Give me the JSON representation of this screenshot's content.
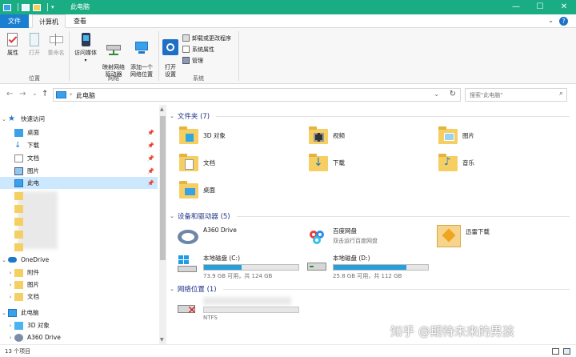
{
  "window": {
    "title": "此电脑",
    "accent": "#1aad84",
    "controls": {
      "minimize": "—",
      "maximize": "☐",
      "close": "✕"
    }
  },
  "ribbon_tabs": {
    "file": "文件",
    "computer": "计算机",
    "view": "查看",
    "help": "?"
  },
  "ribbon": {
    "location": {
      "label": "位置",
      "properties": "属性",
      "open": "打开",
      "rename": "重命名"
    },
    "network": {
      "label": "网络",
      "access_media": "访问媒体",
      "map_drive": "映射网络\n驱动器",
      "add_location": "添加一个\n网络位置"
    },
    "system": {
      "label": "系统",
      "open_settings": "打开\n设置",
      "uninstall": "卸载或更改程序",
      "system_properties": "系统属性",
      "manage": "管理"
    }
  },
  "address": {
    "back": "←",
    "forward": "→",
    "recent": "⌄",
    "up": "↑",
    "crumb": "此电脑",
    "crumb_separator": "›",
    "search_placeholder": "搜索\"此电脑\""
  },
  "nav": {
    "quick_access": "快速访问",
    "desktop": "桌面",
    "downloads": "下载",
    "documents": "文档",
    "pictures": "图片",
    "this_pc_partial": "此电",
    "onedrive": "OneDrive",
    "attachments": "附件",
    "od_pictures": "图片",
    "od_documents": "文档",
    "this_pc": "此电脑",
    "objects3d": "3D 对象",
    "a360": "A360 Drive"
  },
  "content": {
    "folders_header": "文件夹 (7)",
    "folders": [
      "3D 对象",
      "视频",
      "图片",
      "文档",
      "下载",
      "音乐",
      "桌面"
    ],
    "devices_header": "设备和驱动器 (5)",
    "devices": {
      "a360": "A360 Drive",
      "baidu_name": "百度网盘",
      "baidu_desc": "双击运行百度网盘",
      "xunlei": "迅雷下载",
      "c_name": "本地磁盘 (C:)",
      "c_space": "73.9 GB 可用，共 124 GB",
      "c_used": 0.4,
      "d_name": "本地磁盘 (D:)",
      "d_space": "25.8 GB 可用，共 112 GB",
      "d_used": 0.77
    },
    "network_header": "网络位置 (1)",
    "network": {
      "fs": "NTFS"
    }
  },
  "status": {
    "count": "13 个项目"
  },
  "watermark": "知乎 @期待未来的男孩"
}
